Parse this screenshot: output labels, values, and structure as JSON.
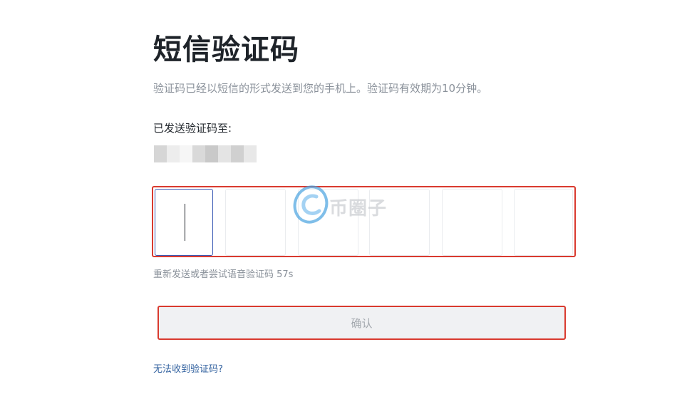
{
  "page": {
    "title": "短信验证码",
    "subtitle": "验证码已经以短信的形式发送到您的手机上。验证码有效期为10分钟。",
    "sent_to_label": "已发送验证码至:",
    "resend_text": "重新发送或者尝试语音验证码 57s",
    "confirm_label": "确认",
    "help_link": "无法收到验证码?"
  },
  "otp": {
    "digits": [
      "",
      "",
      "",
      "",
      "",
      ""
    ],
    "active_index": 0
  },
  "watermark": {
    "text": "币圈子",
    "logo_icon": "coin-logo-icon"
  },
  "colors": {
    "title": "#1e2329",
    "muted_text": "#8a919a",
    "link": "#2f5f9e",
    "active_border": "#3b5bb5",
    "highlight_outline": "#d93a2f",
    "button_bg": "#f0f1f3"
  }
}
